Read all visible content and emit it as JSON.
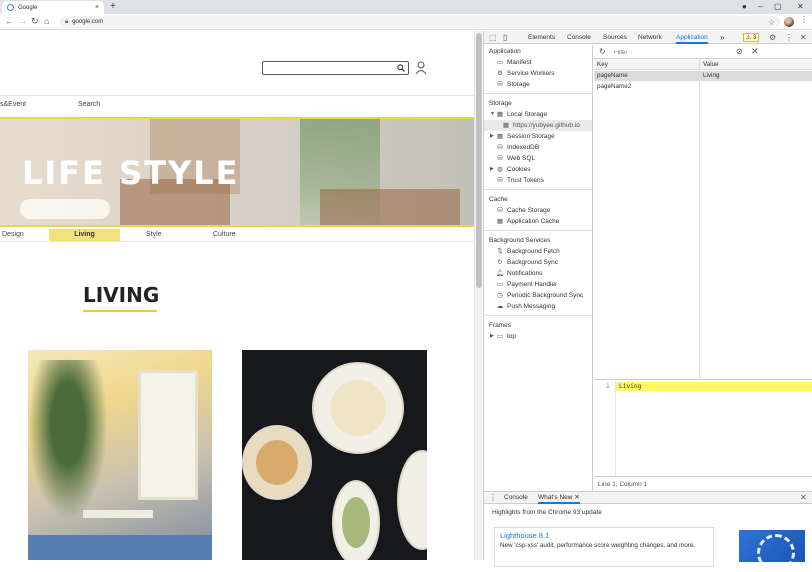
{
  "browser": {
    "tab_title": "Google",
    "address": "google.com",
    "new_tab": "+",
    "tab_close": "×"
  },
  "site": {
    "top_nav": [
      "s&Event",
      "Search"
    ],
    "hero_title": "LIFE STYLE",
    "sub_nav": [
      "Design",
      "Living",
      "Style",
      "Culture"
    ],
    "active_sub_nav": "Living",
    "section_heading": "LIVING"
  },
  "devtools": {
    "tabs": [
      "Elements",
      "Console",
      "Sources",
      "Network",
      "Application"
    ],
    "active_tab": "Application",
    "more": "»",
    "warnings": "3",
    "sidebar": {
      "application": {
        "title": "Application",
        "items": [
          "Manifest",
          "Service Workers",
          "Storage"
        ]
      },
      "storage": {
        "title": "Storage",
        "local_storage": "Local Storage",
        "local_storage_origin": "https://yubyee.github.io",
        "items": [
          "Session Storage",
          "IndexedDB",
          "Web SQL",
          "Cookies",
          "Trust Tokens"
        ]
      },
      "cache": {
        "title": "Cache",
        "items": [
          "Cache Storage",
          "Application Cache"
        ]
      },
      "background": {
        "title": "Background Services",
        "items": [
          "Background Fetch",
          "Background Sync",
          "Notifications",
          "Payment Handler",
          "Periodic Background Sync",
          "Push Messaging"
        ]
      },
      "frames": {
        "title": "Frames",
        "items": [
          "top"
        ]
      }
    },
    "filter_placeholder": "Filter",
    "table": {
      "headers": [
        "Key",
        "Value"
      ],
      "rows": [
        {
          "key": "pageName",
          "value": "Living"
        },
        {
          "key": "pageName2",
          "value": ""
        }
      ]
    },
    "editor": {
      "line_number": "1",
      "content": "Living"
    },
    "status": "Line 1, Column 1",
    "drawer": {
      "tabs": [
        "Console",
        "What's New"
      ],
      "active_tab": "What's New",
      "highlights": "Highlights from the Chrome 93 update",
      "card_title": "Lighthouse 8.1",
      "card_text": "New 'csp-xss' audit, performance score weighting changes, and more."
    }
  },
  "colors": {
    "accent": "#1a73e8",
    "highlight": "#f1e37a",
    "editor_line": "#fff766"
  }
}
